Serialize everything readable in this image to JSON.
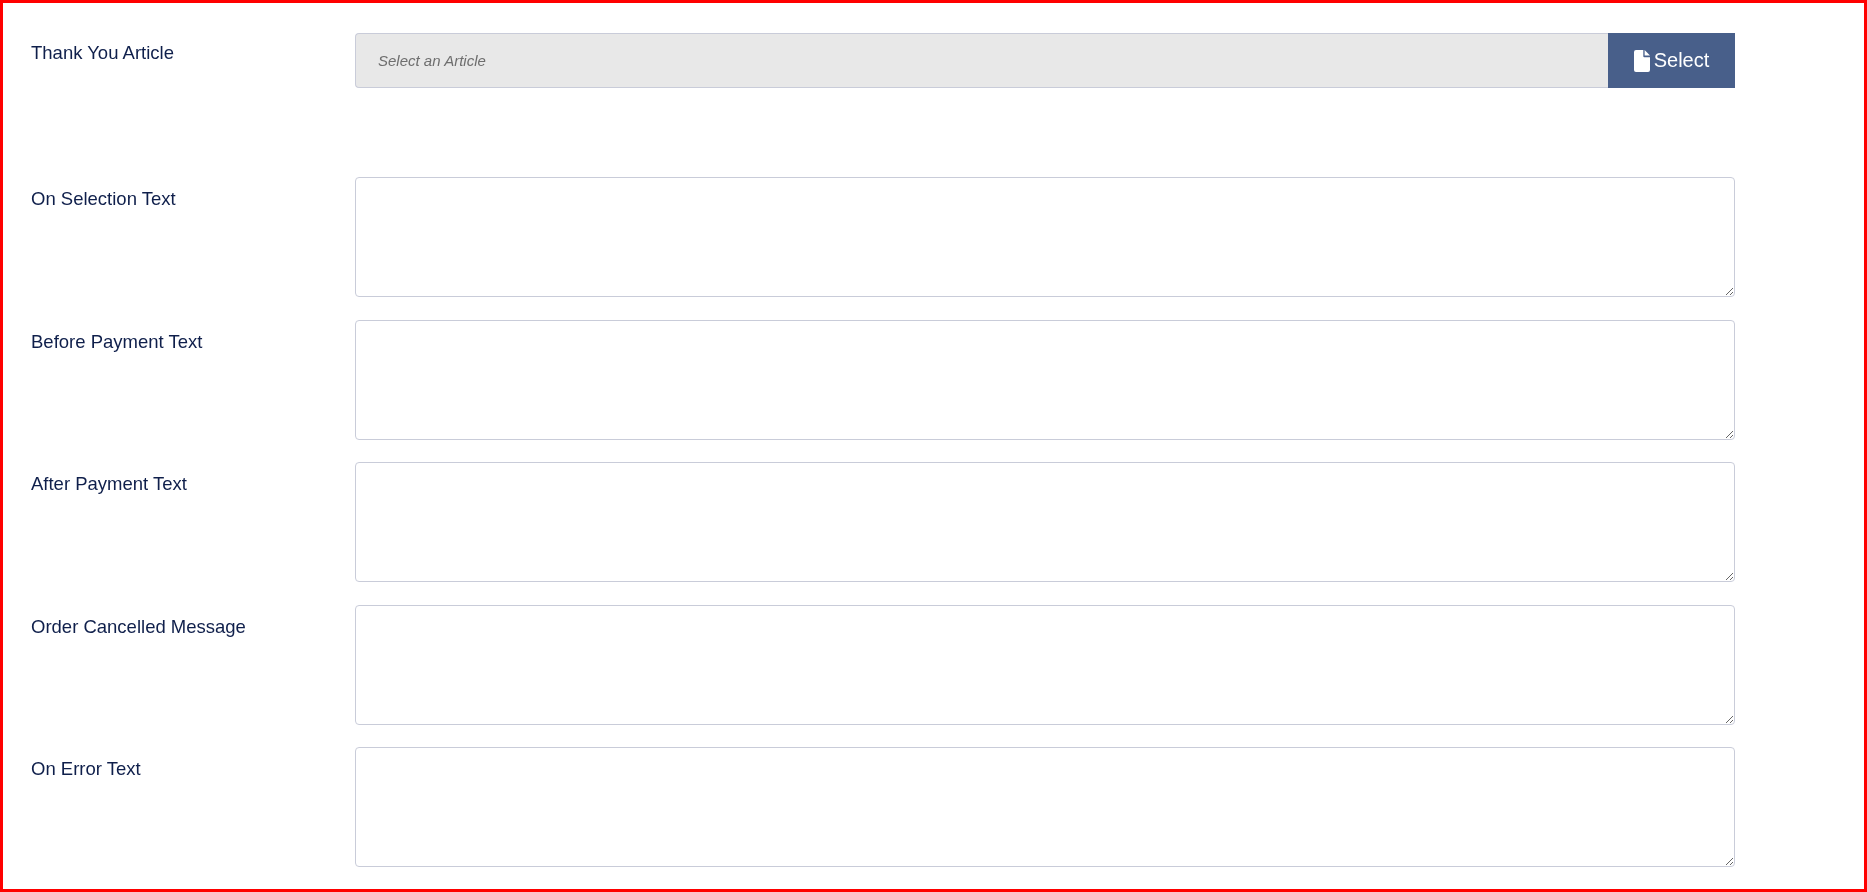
{
  "fields": [
    {
      "kind": "picker",
      "label": "Thank You Article",
      "placeholder": "Select an Article",
      "button": "Select"
    },
    {
      "kind": "textarea",
      "label": "On Selection Text"
    },
    {
      "kind": "textarea",
      "label": "Before Payment Text"
    },
    {
      "kind": "textarea",
      "label": "After Payment Text"
    },
    {
      "kind": "textarea",
      "label": "Order Cancelled Message"
    },
    {
      "kind": "textarea",
      "label": "On Error Text"
    }
  ]
}
